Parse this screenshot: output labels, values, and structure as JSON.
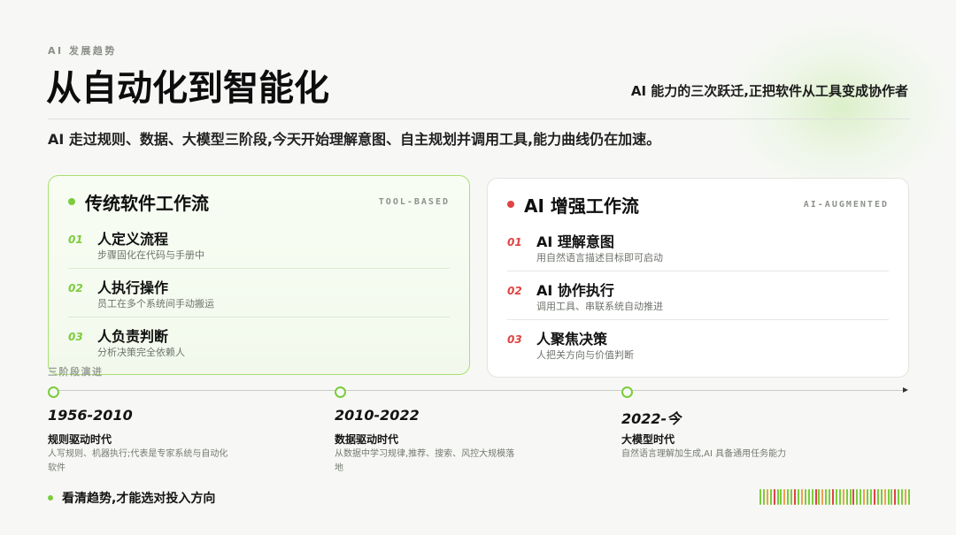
{
  "header": {
    "eyebrow": "AI 发展趋势",
    "title": "从自动化到智能化",
    "tagline": "AI 能力的三次跃迁,正把软件从工具变成协作者"
  },
  "intro": "AI 走过规则、数据、大模型三阶段,今天开始理解意图、自主规划并调用工具,能力曲线仍在加速。",
  "cards": {
    "traditional": {
      "title": "传统软件工作流",
      "tag": "TOOL-BASED",
      "accent": "#7ccc3c",
      "items": [
        {
          "num": "01",
          "title": "人定义流程",
          "desc": "步骤固化在代码与手册中"
        },
        {
          "num": "02",
          "title": "人执行操作",
          "desc": "员工在多个系统间手动搬运"
        },
        {
          "num": "03",
          "title": "人负责判断",
          "desc": "分析决策完全依赖人"
        }
      ]
    },
    "ai": {
      "title": "AI 增强工作流",
      "tag": "AI-AUGMENTED",
      "accent": "#e04343",
      "items": [
        {
          "num": "01",
          "title": "AI 理解意图",
          "desc": "用自然语言描述目标即可启动"
        },
        {
          "num": "02",
          "title": "AI 协作执行",
          "desc": "调用工具、串联系统自动推进"
        },
        {
          "num": "03",
          "title": "人聚焦决策",
          "desc": "人把关方向与价值判断"
        }
      ]
    }
  },
  "timeline": {
    "label": "三阶段演进",
    "stages": [
      {
        "year": "1956-2010",
        "era": "规则驱动时代",
        "desc": "人写规则、机器执行;代表是专家系统与自动化软件"
      },
      {
        "year": "2010-2022",
        "era": "数据驱动时代",
        "desc": "从数据中学习规律,推荐、搜索、风控大规模落地"
      },
      {
        "year": "2022-今",
        "era": "大模型时代",
        "desc": "自然语言理解加生成,AI 具备通用任务能力"
      }
    ]
  },
  "footer": {
    "text": "看清趋势,才能选对投入方向"
  },
  "colors": {
    "green": "#7ccc3c",
    "red": "#e04343",
    "orange": "#f0a04a",
    "background": "#f7f8f6"
  }
}
